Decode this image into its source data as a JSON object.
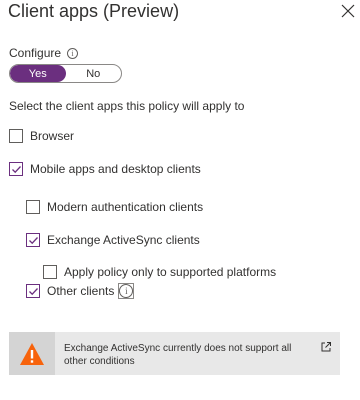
{
  "header": {
    "title": "Client apps (Preview)"
  },
  "configure": {
    "label": "Configure",
    "info_glyph": "i",
    "toggle": {
      "yes_label": "Yes",
      "no_label": "No",
      "selected": "Yes"
    }
  },
  "instruction": "Select the client apps this policy will apply to",
  "options": {
    "browser": {
      "label": "Browser",
      "checked": false
    },
    "mobile_desktop": {
      "label": "Mobile apps and desktop clients",
      "checked": true
    },
    "modern_auth": {
      "label": "Modern authentication clients",
      "checked": false
    },
    "exchange_activesync": {
      "label": "Exchange ActiveSync clients",
      "checked": true
    },
    "supported_platforms": {
      "label": "Apply policy only to supported platforms",
      "checked": false
    },
    "other_clients": {
      "label": "Other clients",
      "checked": true,
      "info_glyph": "i"
    }
  },
  "warning": {
    "text": "Exchange ActiveSync currently does not support all other conditions",
    "icon": "warning-icon",
    "link_icon": "external-link-icon"
  },
  "colors": {
    "accent": "#6b2f7f",
    "warning_orange": "#f7630c",
    "warning_bg": "#e8e8e8"
  }
}
